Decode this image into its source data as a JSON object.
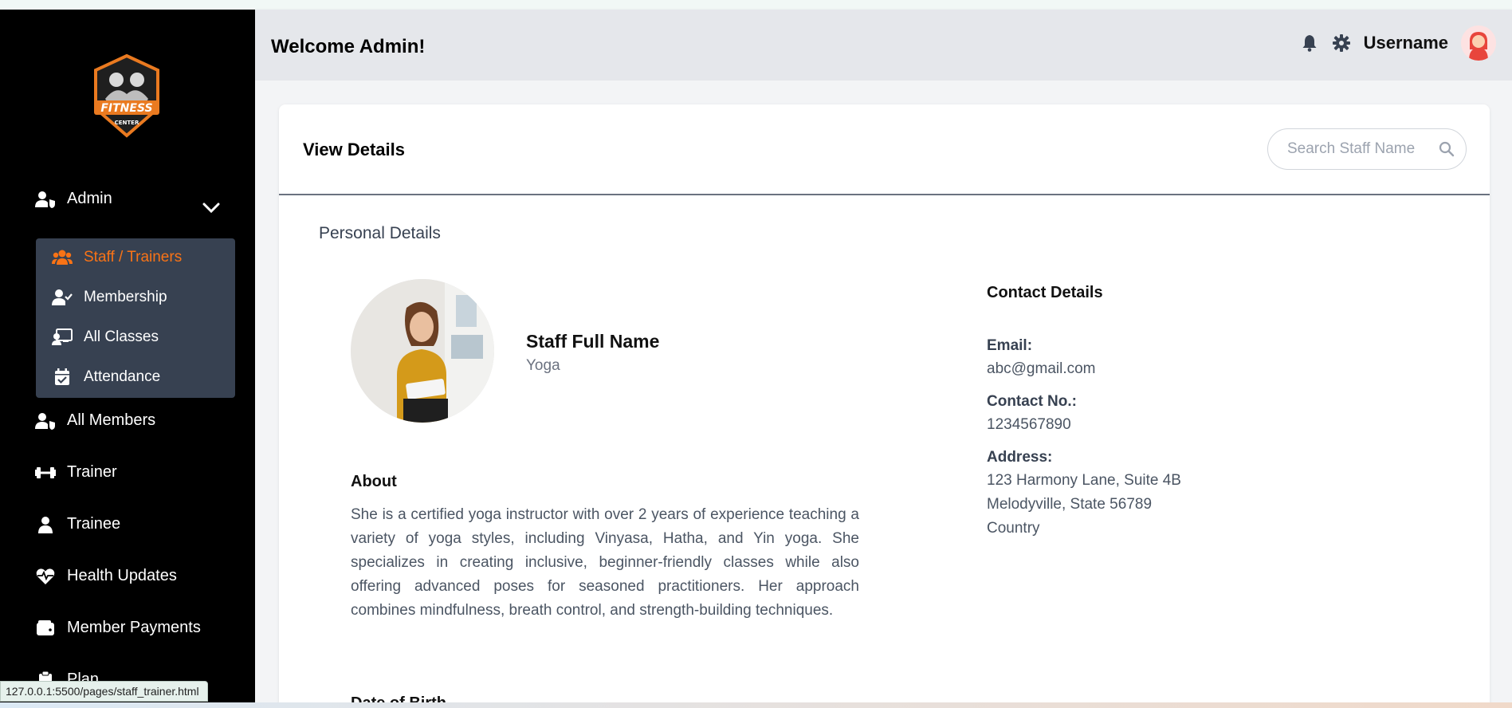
{
  "sidebar": {
    "logo": {
      "text": "FITNESS",
      "subtext": "CENTER"
    },
    "admin": {
      "label": "Admin",
      "icon": "user-shield-icon"
    },
    "submenu": [
      {
        "label": "Staff / Trainers",
        "icon": "users-icon",
        "active": true
      },
      {
        "label": "Membership",
        "icon": "user-check-icon"
      },
      {
        "label": "All Classes",
        "icon": "chalkboard-icon"
      },
      {
        "label": "Attendance",
        "icon": "calendar-check-icon"
      }
    ],
    "items": [
      {
        "label": "All Members",
        "icon": "user-shield-icon"
      },
      {
        "label": "Trainer",
        "icon": "dumbbell-icon"
      },
      {
        "label": "Trainee",
        "icon": "user-icon"
      },
      {
        "label": "Health Updates",
        "icon": "heart-pulse-icon"
      },
      {
        "label": "Member Payments",
        "icon": "wallet-icon"
      },
      {
        "label": "Plan",
        "icon": "clipboard-icon"
      }
    ]
  },
  "header": {
    "welcome": "Welcome Admin!",
    "username": "Username"
  },
  "card": {
    "title": "View Details",
    "search_placeholder": "Search Staff Name",
    "section_title": "Personal Details",
    "staff_name": "Staff Full Name",
    "staff_role": "Yoga",
    "about_title": "About",
    "about_text": "She is a certified yoga instructor with over 2 years of experience teaching a variety of yoga styles, including Vinyasa, Hatha, and Yin yoga. She specializes in creating inclusive, beginner-friendly classes while also offering advanced poses for seasoned practitioners. Her approach combines mindfulness, breath control, and strength-building techniques.",
    "dob_title": "Date of Birth",
    "contact": {
      "title": "Contact Details",
      "email_label": "Email:",
      "email": "abc@gmail.com",
      "phone_label": "Contact No.:",
      "phone": "1234567890",
      "address_label": "Address:",
      "address_line1": "123 Harmony Lane, Suite 4B",
      "address_line2": "Melodyville, State 56789",
      "address_line3": "Country"
    }
  },
  "status_url": "127.0.0.1:5500/pages/staff_trainer.html",
  "colors": {
    "accent": "#f97316",
    "sidebar_bg": "#000000",
    "submenu_bg": "#374151",
    "header_bg": "#e5e7eb"
  }
}
